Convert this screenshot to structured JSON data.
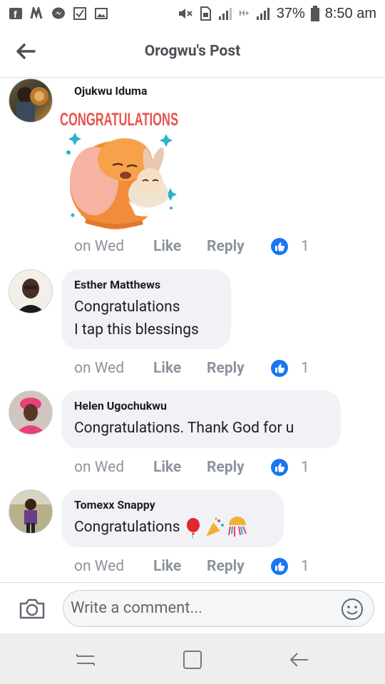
{
  "status_bar": {
    "battery": "37%",
    "time": "8:50 am",
    "network": "H+"
  },
  "header": {
    "title": "Orogwu's Post"
  },
  "comments": [
    {
      "author": "Ojukwu Iduma",
      "sticker_text": "CONGRATULATIONS",
      "time": "on Wed",
      "like_label": "Like",
      "reply_label": "Reply",
      "likes": "1"
    },
    {
      "author": "Esther Matthews",
      "lines": [
        "Congratulations",
        "I tap this blessings"
      ],
      "time": "on Wed",
      "like_label": "Like",
      "reply_label": "Reply",
      "likes": "1"
    },
    {
      "author": "Helen Ugochukwu",
      "lines": [
        "Congratulations. Thank God for u"
      ],
      "time": "on Wed",
      "like_label": "Like",
      "reply_label": "Reply",
      "likes": "1"
    },
    {
      "author": "Tomexx Snappy",
      "lines": [
        "Congratulations"
      ],
      "emojis": [
        "balloon",
        "party-popper",
        "confetti-ball"
      ],
      "time": "on Wed",
      "like_label": "Like",
      "reply_label": "Reply",
      "likes": "1"
    }
  ],
  "composer": {
    "placeholder": "Write a comment..."
  },
  "colors": {
    "accent": "#1877f2",
    "bubble": "#f0f2f5",
    "muted": "#8d949e",
    "sticker_text": "#e8534f"
  },
  "icons": {
    "back": "arrow-left-icon",
    "like": "thumbs-up-icon",
    "camera": "camera-icon",
    "emoji": "smiley-icon",
    "nav": [
      "recents-icon",
      "home-icon",
      "back-icon"
    ]
  }
}
